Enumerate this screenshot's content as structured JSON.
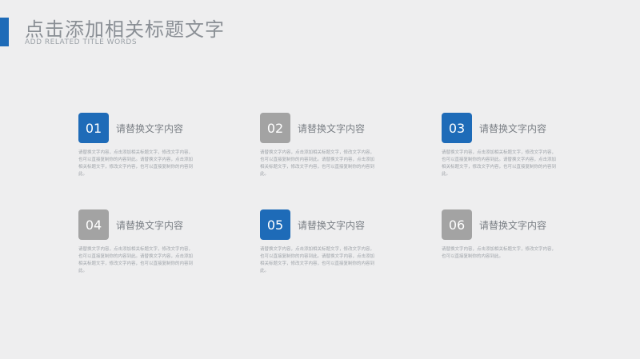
{
  "header": {
    "title": "点击添加相关标题文字",
    "subtitle": "ADD RELATED TITLE WORDS"
  },
  "colors": {
    "blue": "#1e6bb8",
    "gray": "#a3a3a3"
  },
  "cards": [
    {
      "number": "01",
      "heading": "请替换文字内容",
      "color": "blue",
      "body": "请替换文字内容，点击添加相关标题文字，修改文字内容，也可以直接复制你的内容到此。请替换文字内容，点击添加相关标题文字，修改文字内容，也可以直接复制你的内容到此。"
    },
    {
      "number": "02",
      "heading": "请替换文字内容",
      "color": "gray",
      "body": "请替换文字内容，点击添加相关标题文字，修改文字内容，也可以直接复制你的内容到此。请替换文字内容，点击添加相关标题文字，修改文字内容，也可以直接复制你的内容到此。"
    },
    {
      "number": "03",
      "heading": "请替换文字内容",
      "color": "blue",
      "body": "请替换文字内容，点击添加相关标题文字，修改文字内容，也可以直接复制你的内容到此。请替换文字内容，点击添加相关标题文字，修改文字内容，也可以直接复制你的内容到此。"
    },
    {
      "number": "04",
      "heading": "请替换文字内容",
      "color": "gray",
      "body": "请替换文字内容，点击添加相关标题文字，修改文字内容，也可以直接复制你的内容到此。请替换文字内容，点击添加相关标题文字，修改文字内容，也可以直接复制你的内容到此。"
    },
    {
      "number": "05",
      "heading": "请替换文字内容",
      "color": "blue",
      "body": "请替换文字内容，点击添加相关标题文字，修改文字内容，也可以直接复制你的内容到此。请替换文字内容，点击添加相关标题文字，修改文字内容，也可以直接复制你的内容到此。"
    },
    {
      "number": "06",
      "heading": "请替换文字内容",
      "color": "gray",
      "body": "请替换文字内容，点击添加相关标题文字，修改文字内容，也可以直接复制你的内容到此。"
    }
  ]
}
